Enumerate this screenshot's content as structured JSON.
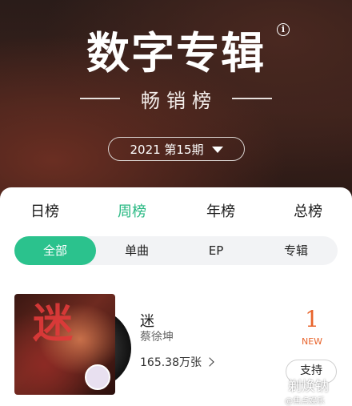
{
  "header": {
    "title": "数字专辑",
    "info_icon": "i",
    "subtitle": "畅销榜",
    "period": "2021 第15期"
  },
  "tabs": [
    {
      "label": "日榜",
      "active": false
    },
    {
      "label": "周榜",
      "active": true
    },
    {
      "label": "年榜",
      "active": false
    },
    {
      "label": "总榜",
      "active": false
    }
  ],
  "filters": [
    {
      "label": "全部",
      "active": true
    },
    {
      "label": "单曲",
      "active": false
    },
    {
      "label": "EP",
      "active": false
    },
    {
      "label": "专辑",
      "active": false
    }
  ],
  "item": {
    "cover_text": "迷",
    "title": "迷",
    "artist": "蔡徐坤",
    "sales": "165.38万张",
    "rank": "1",
    "badge": "NEW",
    "support_label": "支持"
  },
  "watermark": {
    "main": "剃焕钠",
    "sub": "@焦点娱乐"
  },
  "colors": {
    "accent": "#27b882",
    "rank": "#e8642c"
  }
}
